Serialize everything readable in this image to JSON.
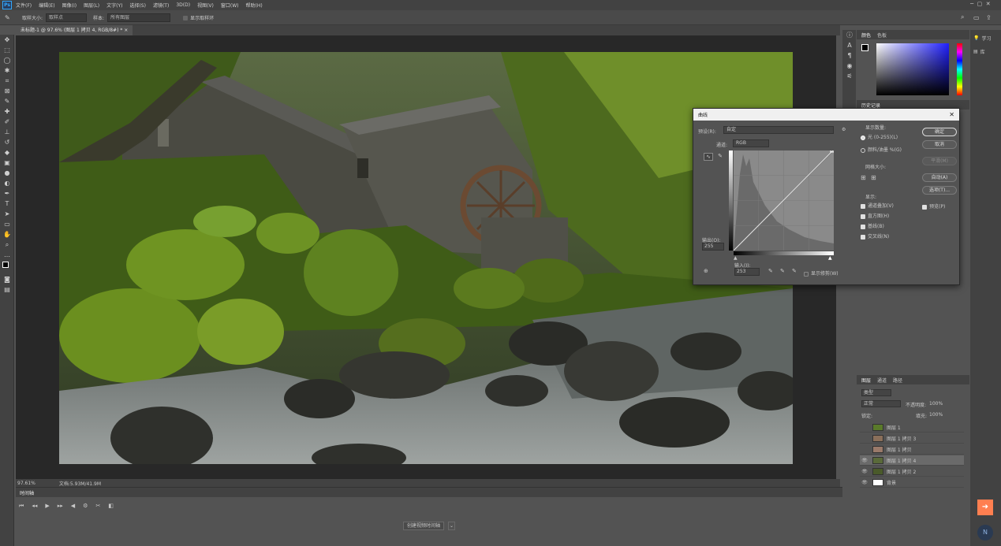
{
  "app": {
    "logo": "Ps"
  },
  "menu": [
    "文件(F)",
    "编辑(E)",
    "图像(I)",
    "图层(L)",
    "文字(Y)",
    "选择(S)",
    "滤镜(T)",
    "3D(D)",
    "视图(V)",
    "窗口(W)",
    "帮助(H)"
  ],
  "options": {
    "sample_size_label": "取样大小:",
    "sample_size_value": "取样点",
    "sample_label": "样本:",
    "sample_value": "所有图层",
    "show_ring": "显示取样环"
  },
  "doc_tab": "未标题-1 @ 97.6% (图层 1 拷贝 4, RGB/8#) *",
  "status": {
    "zoom": "97.61%",
    "doc": "文档:5.93M/41.9M"
  },
  "timeline": {
    "title": "时间轴",
    "create_btn": "创建视频时间轴"
  },
  "color_panel": {
    "tabs": [
      "颜色",
      "色板"
    ]
  },
  "history_tab": "历史记录",
  "curves": {
    "title": "曲线",
    "preset_label": "预设(R):",
    "preset_value": "自定",
    "channel_label": "通道:",
    "channel_value": "RGB",
    "output_label": "输出(O):",
    "output_value": "255",
    "input_label": "输入(I):",
    "input_value": "253",
    "show_clipping": "显示修剪(W)",
    "display_amount": "显示数量:",
    "light": "光 (0-255)(L)",
    "pigment": "颜料/油墨 %(G)",
    "grid_size": "网格大小:",
    "show": "显示:",
    "show_items": [
      "通道叠加(V)",
      "直方图(H)",
      "基线(B)",
      "交叉线(N)"
    ],
    "buttons": {
      "ok": "确定",
      "cancel": "取消",
      "smooth": "平滑(M)",
      "auto": "自动(A)",
      "options": "选项(T)..."
    },
    "preview": "预览(P)"
  },
  "layers_panel": {
    "tabs": [
      "图层",
      "通道",
      "路径"
    ],
    "kind": "类型",
    "blend": "正常",
    "opacity_label": "不透明度:",
    "opacity": "100%",
    "lock_label": "锁定:",
    "fill_label": "填充:",
    "fill": "100%",
    "layers": [
      {
        "name": "图层 1",
        "visible": false,
        "selected": false
      },
      {
        "name": "图层 1 拷贝 3",
        "visible": false,
        "selected": false
      },
      {
        "name": "图层 1 拷贝",
        "visible": false,
        "selected": false
      },
      {
        "name": "图层 1 拷贝 4",
        "visible": true,
        "selected": true
      },
      {
        "name": "图层 1 拷贝 2",
        "visible": true,
        "selected": false
      },
      {
        "name": "背景",
        "visible": true,
        "selected": false
      }
    ]
  },
  "right_strip": {
    "learn": "学习",
    "library": "库"
  },
  "colors": {
    "accent": "#31a8ff",
    "orange": "#ff7f50"
  }
}
